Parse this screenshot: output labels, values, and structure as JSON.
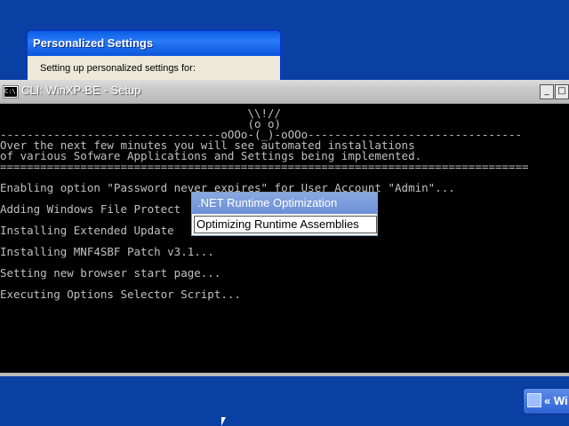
{
  "personalized_settings": {
    "title": "Personalized Settings",
    "message": "Setting up personalized settings for:"
  },
  "console": {
    "title": "CLI: WinXP-BE - Setup",
    "icon": "C:\\",
    "min_glyph": "_",
    "max_glyph": "□",
    "lines": [
      "                                     \\\\!//",
      "                                     (o o)",
      "---------------------------------oOOo-(_)-oOOo--------------------------------",
      "Over the next few minutes you will see automated installations",
      "of various Sofware Applications and Settings being implemented.",
      "===============================================================================",
      "Enabling option \"Password never expires\" for User Account \"Admin\"...",
      "Adding Windows File Protect",
      "Installing Extended Update",
      "Installing MNF4SBF Patch v3.1...",
      "Setting new browser start page...",
      "Executing Options Selector Script..."
    ]
  },
  "net_popup": {
    "title": ".NET Runtime Optimization",
    "status": "Optimizing Runtime Assemblies"
  },
  "taskbar": {
    "button_label": "« Wi"
  }
}
